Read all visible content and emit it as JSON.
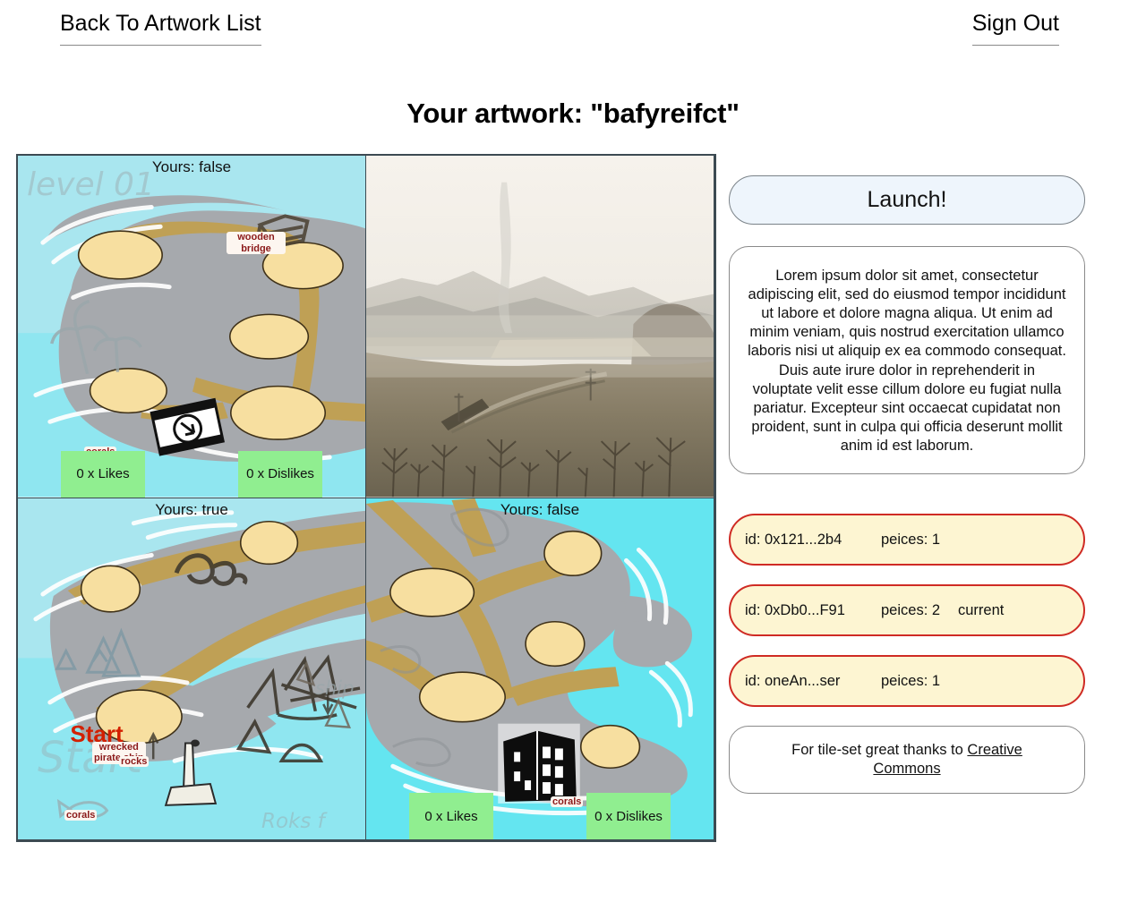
{
  "nav": {
    "back_label": "Back To Artwork List",
    "signout_label": "Sign Out"
  },
  "header": {
    "title": "Your artwork: \"bafyreifct\""
  },
  "grid": {
    "tiles": [
      {
        "position": "top-left",
        "ownership_label": "Yours: false",
        "kind": "map",
        "likes_label": "0 x Likes",
        "dislikes_label": "0 x Dislikes",
        "annotations": [
          "wooden bridge",
          "corals"
        ],
        "sketch_text": "level 01"
      },
      {
        "position": "top-right",
        "ownership_label": "",
        "kind": "photo",
        "likes_label": "",
        "dislikes_label": "",
        "annotations": [],
        "sketch_text": ""
      },
      {
        "position": "bottom-left",
        "ownership_label": "Yours: true",
        "kind": "map",
        "likes_label": "",
        "dislikes_label": "",
        "annotations": [
          "wrecked pirate ship",
          "rocks",
          "corals",
          "ship"
        ],
        "start_label": "Start",
        "sketch_text": "Start"
      },
      {
        "position": "bottom-right",
        "ownership_label": "Yours: false",
        "kind": "map",
        "likes_label": "0 x Likes",
        "dislikes_label": "0 x Dislikes",
        "annotations": [
          "corals"
        ],
        "sketch_text": ""
      }
    ]
  },
  "side": {
    "launch_label": "Launch!",
    "description": "Lorem ipsum dolor sit amet, consectetur adipiscing elit, sed do eiusmod tempor incididunt ut labore et dolore magna aliqua. Ut enim ad minim veniam, quis nostrud exercitation ullamco laboris nisi ut aliquip ex ea commodo consequat. Duis aute irure dolor in reprehenderit in voluptate velit esse cillum dolore eu fugiat nulla pariatur. Excepteur sint occaecat cupidatat non proident, sunt in culpa qui officia deserunt mollit anim id est laborum.",
    "id_cards": [
      {
        "id": "id: 0x121...2b4",
        "pieces": "peices: 1",
        "current": ""
      },
      {
        "id": "id: 0xDb0...F91",
        "pieces": "peices: 2",
        "current": "current"
      },
      {
        "id": "id: oneAn...ser",
        "pieces": "peices: 1",
        "current": ""
      }
    ],
    "credit_prefix": "For tile-set great thanks to ",
    "credit_link": "Creative Commons"
  },
  "colors": {
    "launch_bg": "#eef5fc",
    "badge_green": "#90ee90",
    "card_yellow": "#fdf5d2",
    "card_border_red": "#cf2b24",
    "water": "#7fe9f2",
    "water_light": "#a6e8f0",
    "island": "#a6a9ad",
    "path": "#bfa055",
    "node": "#f7dfa0",
    "label_red": "#8b1a1a"
  }
}
